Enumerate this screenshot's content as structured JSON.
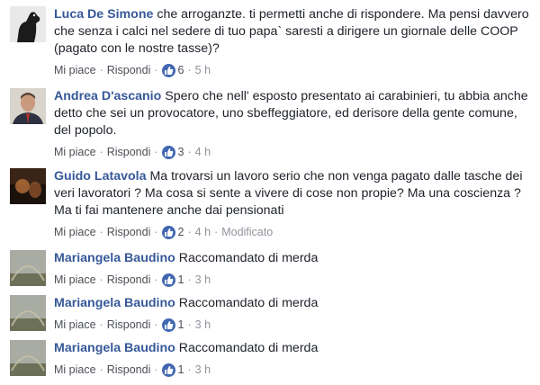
{
  "comments": [
    {
      "author": "Luca De Simone",
      "text": "che arroganzte. ti permetti anche di rispondere. Ma pensi davvero che senza i calci nel sedere di tuo papa` saresti a dirigere un giornale delle COOP (pagato con le nostre tasse)?",
      "like_label": "Mi piace",
      "reply_label": "Rispondi",
      "reactions": "6",
      "time": "5 h",
      "edited": "",
      "avatar": "dog-avatar"
    },
    {
      "author": "Andrea D'ascanio",
      "text": "Spero che nell' esposto presentato ai carabinieri, tu abbia anche detto che sei un provocatore, uno sbeffeggiatore, ed derisore della gente comune, del popolo.",
      "like_label": "Mi piace",
      "reply_label": "Rispondi",
      "reactions": "3",
      "time": "4 h",
      "edited": "",
      "avatar": "man-avatar"
    },
    {
      "author": "Guido Latavola",
      "text": "Ma trovarsi un lavoro serio che non venga pagato dalle tasche dei veri lavoratori ? Ma cosa si sente a vivere di cose non propie? Ma una coscienza ? Ma ti fai mantenere anche dai pensionati",
      "like_label": "Mi piace",
      "reply_label": "Rispondi",
      "reactions": "2",
      "time": "4 h",
      "edited": "Modificato",
      "avatar": "sunset-avatar"
    },
    {
      "author": "Mariangela Baudino",
      "text": "Raccomandato di merda",
      "like_label": "Mi piace",
      "reply_label": "Rispondi",
      "reactions": "1",
      "time": "3 h",
      "edited": "",
      "avatar": "rainbow-avatar"
    },
    {
      "author": "Mariangela Baudino",
      "text": "Raccomandato di merda",
      "like_label": "Mi piace",
      "reply_label": "Rispondi",
      "reactions": "1",
      "time": "3 h",
      "edited": "",
      "avatar": "rainbow-avatar"
    },
    {
      "author": "Mariangela Baudino",
      "text": "Raccomandato di merda",
      "like_label": "Mi piace",
      "reply_label": "Rispondi",
      "reactions": "1",
      "time": "3 h",
      "edited": "",
      "avatar": "rainbow-avatar"
    }
  ],
  "colors": {
    "author": "#365899",
    "like_badge": "#4267b2",
    "meta": "#90949c"
  }
}
